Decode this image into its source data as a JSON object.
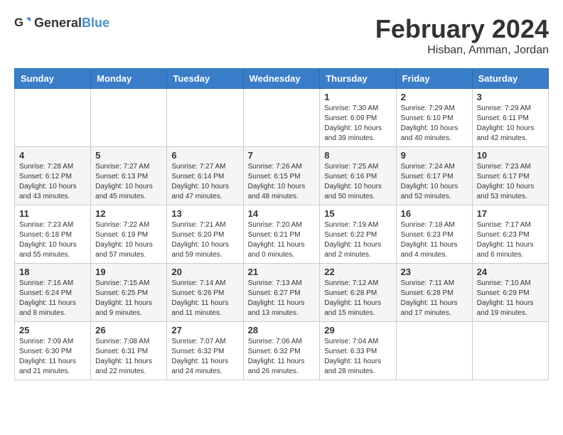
{
  "header": {
    "logo_general": "General",
    "logo_blue": "Blue",
    "month_title": "February 2024",
    "location": "Hisban, Amman, Jordan"
  },
  "weekdays": [
    "Sunday",
    "Monday",
    "Tuesday",
    "Wednesday",
    "Thursday",
    "Friday",
    "Saturday"
  ],
  "weeks": [
    [
      {
        "day": "",
        "info": ""
      },
      {
        "day": "",
        "info": ""
      },
      {
        "day": "",
        "info": ""
      },
      {
        "day": "",
        "info": ""
      },
      {
        "day": "1",
        "info": "Sunrise: 7:30 AM\nSunset: 6:09 PM\nDaylight: 10 hours\nand 39 minutes."
      },
      {
        "day": "2",
        "info": "Sunrise: 7:29 AM\nSunset: 6:10 PM\nDaylight: 10 hours\nand 40 minutes."
      },
      {
        "day": "3",
        "info": "Sunrise: 7:29 AM\nSunset: 6:11 PM\nDaylight: 10 hours\nand 42 minutes."
      }
    ],
    [
      {
        "day": "4",
        "info": "Sunrise: 7:28 AM\nSunset: 6:12 PM\nDaylight: 10 hours\nand 43 minutes."
      },
      {
        "day": "5",
        "info": "Sunrise: 7:27 AM\nSunset: 6:13 PM\nDaylight: 10 hours\nand 45 minutes."
      },
      {
        "day": "6",
        "info": "Sunrise: 7:27 AM\nSunset: 6:14 PM\nDaylight: 10 hours\nand 47 minutes."
      },
      {
        "day": "7",
        "info": "Sunrise: 7:26 AM\nSunset: 6:15 PM\nDaylight: 10 hours\nand 48 minutes."
      },
      {
        "day": "8",
        "info": "Sunrise: 7:25 AM\nSunset: 6:16 PM\nDaylight: 10 hours\nand 50 minutes."
      },
      {
        "day": "9",
        "info": "Sunrise: 7:24 AM\nSunset: 6:17 PM\nDaylight: 10 hours\nand 52 minutes."
      },
      {
        "day": "10",
        "info": "Sunrise: 7:23 AM\nSunset: 6:17 PM\nDaylight: 10 hours\nand 53 minutes."
      }
    ],
    [
      {
        "day": "11",
        "info": "Sunrise: 7:23 AM\nSunset: 6:18 PM\nDaylight: 10 hours\nand 55 minutes."
      },
      {
        "day": "12",
        "info": "Sunrise: 7:22 AM\nSunset: 6:19 PM\nDaylight: 10 hours\nand 57 minutes."
      },
      {
        "day": "13",
        "info": "Sunrise: 7:21 AM\nSunset: 6:20 PM\nDaylight: 10 hours\nand 59 minutes."
      },
      {
        "day": "14",
        "info": "Sunrise: 7:20 AM\nSunset: 6:21 PM\nDaylight: 11 hours\nand 0 minutes."
      },
      {
        "day": "15",
        "info": "Sunrise: 7:19 AM\nSunset: 6:22 PM\nDaylight: 11 hours\nand 2 minutes."
      },
      {
        "day": "16",
        "info": "Sunrise: 7:18 AM\nSunset: 6:23 PM\nDaylight: 11 hours\nand 4 minutes."
      },
      {
        "day": "17",
        "info": "Sunrise: 7:17 AM\nSunset: 6:23 PM\nDaylight: 11 hours\nand 6 minutes."
      }
    ],
    [
      {
        "day": "18",
        "info": "Sunrise: 7:16 AM\nSunset: 6:24 PM\nDaylight: 11 hours\nand 8 minutes."
      },
      {
        "day": "19",
        "info": "Sunrise: 7:15 AM\nSunset: 6:25 PM\nDaylight: 11 hours\nand 9 minutes."
      },
      {
        "day": "20",
        "info": "Sunrise: 7:14 AM\nSunset: 6:26 PM\nDaylight: 11 hours\nand 11 minutes."
      },
      {
        "day": "21",
        "info": "Sunrise: 7:13 AM\nSunset: 6:27 PM\nDaylight: 11 hours\nand 13 minutes."
      },
      {
        "day": "22",
        "info": "Sunrise: 7:12 AM\nSunset: 6:28 PM\nDaylight: 11 hours\nand 15 minutes."
      },
      {
        "day": "23",
        "info": "Sunrise: 7:11 AM\nSunset: 6:28 PM\nDaylight: 11 hours\nand 17 minutes."
      },
      {
        "day": "24",
        "info": "Sunrise: 7:10 AM\nSunset: 6:29 PM\nDaylight: 11 hours\nand 19 minutes."
      }
    ],
    [
      {
        "day": "25",
        "info": "Sunrise: 7:09 AM\nSunset: 6:30 PM\nDaylight: 11 hours\nand 21 minutes."
      },
      {
        "day": "26",
        "info": "Sunrise: 7:08 AM\nSunset: 6:31 PM\nDaylight: 11 hours\nand 22 minutes."
      },
      {
        "day": "27",
        "info": "Sunrise: 7:07 AM\nSunset: 6:32 PM\nDaylight: 11 hours\nand 24 minutes."
      },
      {
        "day": "28",
        "info": "Sunrise: 7:06 AM\nSunset: 6:32 PM\nDaylight: 11 hours\nand 26 minutes."
      },
      {
        "day": "29",
        "info": "Sunrise: 7:04 AM\nSunset: 6:33 PM\nDaylight: 11 hours\nand 28 minutes."
      },
      {
        "day": "",
        "info": ""
      },
      {
        "day": "",
        "info": ""
      }
    ]
  ]
}
